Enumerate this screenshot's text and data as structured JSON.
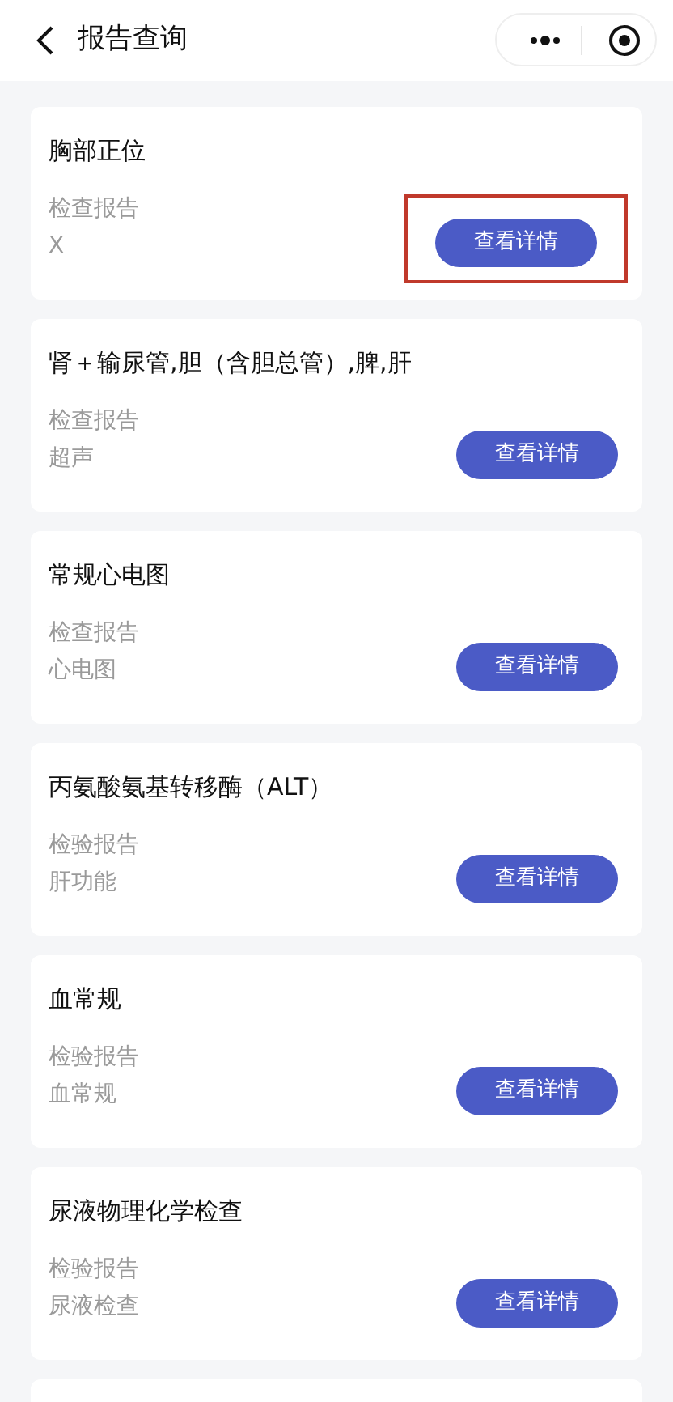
{
  "header": {
    "title": "报告查询"
  },
  "reports": [
    {
      "title": "胸部正位",
      "category": "检查报告",
      "subtype": "X",
      "button": "查看详情",
      "highlighted": true
    },
    {
      "title": "肾＋输尿管,胆（含胆总管）,脾,肝",
      "category": "检查报告",
      "subtype": "超声",
      "button": "查看详情",
      "highlighted": false
    },
    {
      "title": "常规心电图",
      "category": "检查报告",
      "subtype": "心电图",
      "button": "查看详情",
      "highlighted": false
    },
    {
      "title": "丙氨酸氨基转移酶（ALT）",
      "category": "检验报告",
      "subtype": "肝功能",
      "button": "查看详情",
      "highlighted": false
    },
    {
      "title": "血常规",
      "category": "检验报告",
      "subtype": "血常规",
      "button": "查看详情",
      "highlighted": false
    },
    {
      "title": "尿液物理化学检查",
      "category": "检验报告",
      "subtype": "尿液检查",
      "button": "查看详情",
      "highlighted": false
    }
  ]
}
